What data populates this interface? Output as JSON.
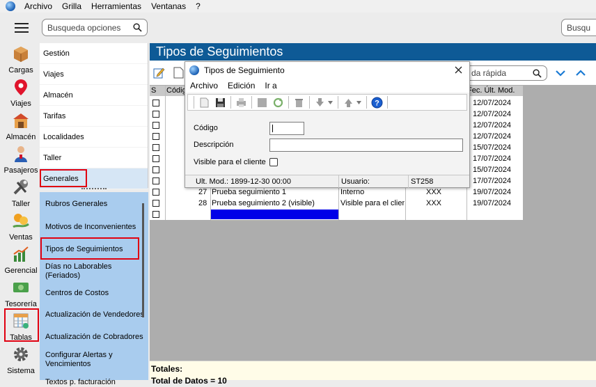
{
  "menubar": {
    "items": [
      "Archivo",
      "Grilla",
      "Herramientas",
      "Ventanas",
      "?"
    ]
  },
  "search": {
    "left_placeholder": "Busqueda opciones",
    "right_placeholder": "Busqu"
  },
  "sidebar_icons": [
    {
      "label": "Cargas",
      "icon": "box-icon"
    },
    {
      "label": "Viajes",
      "icon": "map-pin-icon"
    },
    {
      "label": "Almacén",
      "icon": "warehouse-icon"
    },
    {
      "label": "Pasajeros",
      "icon": "passenger-icon"
    },
    {
      "label": "Taller",
      "icon": "wrench-icon"
    },
    {
      "label": "Ventas",
      "icon": "sales-icon"
    },
    {
      "label": "Gerencial",
      "icon": "chart-icon"
    },
    {
      "label": "Tesorería",
      "icon": "money-icon"
    },
    {
      "label": "Tablas",
      "icon": "table-icon"
    },
    {
      "label": "Sistema",
      "icon": "gear-icon"
    }
  ],
  "menu": {
    "items": [
      "Gestión",
      "Viajes",
      "Almacén",
      "Tarifas",
      "Localidades",
      "Taller",
      "Generales"
    ]
  },
  "submenu": {
    "items": [
      "Rubros Generales",
      "Motivos de Inconvenientes",
      "Tipos de Seguimientos",
      "Días no Laborables (Feriados)",
      "Centros de Costos",
      "Actualización de Vendedores",
      "Actualización de Cobradores",
      "Configurar Alertas y Vencimientos",
      "Textos p. facturación"
    ]
  },
  "main": {
    "title": "Tipos de Seguimientos",
    "quick_search": "da rápida",
    "grid": {
      "headers": [
        "S",
        "Códig",
        "Fec. Últ. Mod."
      ],
      "dates": [
        "12/07/2024",
        "12/07/2024",
        "12/07/2024",
        "12/07/2024",
        "15/07/2024",
        "17/07/2024",
        "15/07/2024",
        "17/07/2024",
        "19/07/2024",
        "19/07/2024"
      ],
      "rows": [
        {
          "code": "27",
          "desc": "Prueba seguimiento 1",
          "visibility": "Interno",
          "user": "XXX"
        },
        {
          "code": "28",
          "desc": "Prueba seguimiento 2 (visible)",
          "visibility": "Visible para el client",
          "user": "XXX"
        }
      ]
    },
    "totals_label": "Totales:",
    "totals_count": "Total de Datos = 10"
  },
  "dialog": {
    "title": "Tipos de Seguimiento",
    "menu": [
      "Archivo",
      "Edición",
      "Ir a"
    ],
    "fields": {
      "code": "Código",
      "description": "Descripción",
      "visible": "Visible para el cliente"
    },
    "status": {
      "last_mod": "Ult. Mod.: 1899-12-30 00:00",
      "user_label": "Usuario:",
      "user": "ST258"
    }
  },
  "colors": {
    "header_blue": "#0e5a96",
    "submenu_blue": "#a9ccee",
    "highlight_red": "#e00010"
  }
}
